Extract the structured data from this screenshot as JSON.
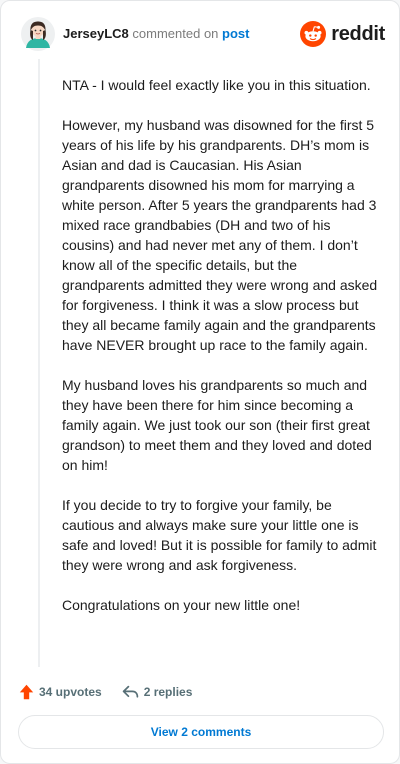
{
  "header": {
    "username": "JerseyLC8",
    "action_text": "commented on",
    "post_link": "post",
    "brand": "reddit"
  },
  "icons": {
    "avatar": "avatar-icon",
    "brand": "reddit-alien-icon",
    "upvote": "upvote-arrow-icon",
    "reply": "reply-arrow-icon"
  },
  "colors": {
    "reddit_orange": "#ff4500",
    "link_blue": "#0079d3",
    "action_grey": "#576f76"
  },
  "comment": {
    "paragraphs": [
      "NTA - I would feel exactly like you in this situation.",
      "However, my husband was disowned for the first 5 years of his life by his grandparents. DH’s mom is Asian and dad is Caucasian. His Asian grandparents disowned his mom for marrying a white person. After 5 years the grandparents had 3 mixed race grandbabies (DH and two of his cousins) and had never met any of them. I don’t know all of the specific details, but the grandparents admitted they were wrong and asked for forgiveness. I think it was a slow process but they all became family again and the grandparents have NEVER brought up race to the family again.",
      "My husband loves his grandparents so much and they have been there for him since becoming a family again. We just took our son (their first great grandson) to meet them and they loved and doted on him!",
      "If you decide to try to forgive your family, be cautious and always make sure your little one is safe and loved! But it is possible for family to admit they were wrong and ask forgiveness.",
      "Congratulations on your new little one!"
    ]
  },
  "actions": {
    "upvotes": "34 upvotes",
    "replies": "2 replies"
  },
  "footer": {
    "view_comments": "View 2 comments"
  }
}
